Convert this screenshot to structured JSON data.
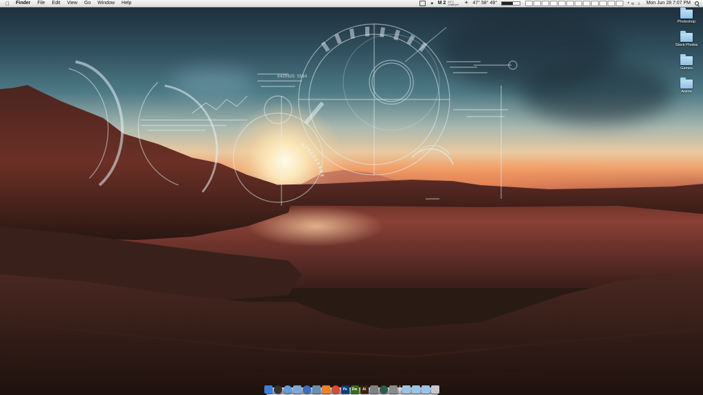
{
  "menubar": {
    "apple_icon": "apple-icon",
    "app_name": "Finder",
    "menus": [
      "File",
      "Edit",
      "View",
      "Go",
      "Window",
      "Help"
    ],
    "status": {
      "gmail_count": "M 2",
      "temperature_top": "49°C",
      "temperature_bottom": "2286rpm",
      "weather": "47° 58° 49°",
      "cpu_usage": 0.6,
      "clock": "Mon Jun 28  7:07 PM"
    }
  },
  "desktop": {
    "icons": [
      {
        "label": "Photoshop",
        "icon": "folder-icon"
      },
      {
        "label": "Stock Photos",
        "icon": "folder-icon"
      },
      {
        "label": "Games",
        "icon": "folder-icon"
      },
      {
        "label": "Anime",
        "icon": "folder-icon"
      }
    ],
    "hud_number": "0425925 5594"
  },
  "dock": {
    "apps": [
      {
        "name": "finder-icon",
        "glyph": "",
        "color": "#3d7fd6"
      },
      {
        "name": "dashboard-icon",
        "glyph": "",
        "color": "#333"
      },
      {
        "name": "safari-icon",
        "glyph": "",
        "color": "#5aa0e0"
      },
      {
        "name": "mail-icon",
        "glyph": "",
        "color": "#7ea8d8"
      },
      {
        "name": "itunes-icon",
        "glyph": "",
        "color": "#3a6fc0"
      },
      {
        "name": "iphoto-icon",
        "glyph": "",
        "color": "#6a8fb0"
      },
      {
        "name": "vlc-icon",
        "glyph": "",
        "color": "#f08020"
      },
      {
        "name": "chrome-icon",
        "glyph": "",
        "color": "#d94b3a"
      },
      {
        "name": "photoshop-icon",
        "glyph": "Ps",
        "color": "#0b3d78"
      },
      {
        "name": "dreamweaver-icon",
        "glyph": "Dw",
        "color": "#3b6b1a"
      },
      {
        "name": "illustrator-icon",
        "glyph": "Ai",
        "color": "#3a2210"
      },
      {
        "name": "utility-icon",
        "glyph": "",
        "color": "#808080"
      },
      {
        "name": "time-machine-icon",
        "glyph": "",
        "color": "#2a5a4a"
      },
      {
        "name": "system-preferences-icon",
        "glyph": "",
        "color": "#8a8a8a"
      }
    ],
    "stacks": [
      {
        "name": "applications-stack-icon",
        "color": "#9bc5e8"
      },
      {
        "name": "documents-stack-icon",
        "color": "#9bc5e8"
      },
      {
        "name": "downloads-stack-icon",
        "color": "#9bc5e8"
      },
      {
        "name": "trash-icon",
        "color": "#c8c8c8"
      }
    ]
  }
}
